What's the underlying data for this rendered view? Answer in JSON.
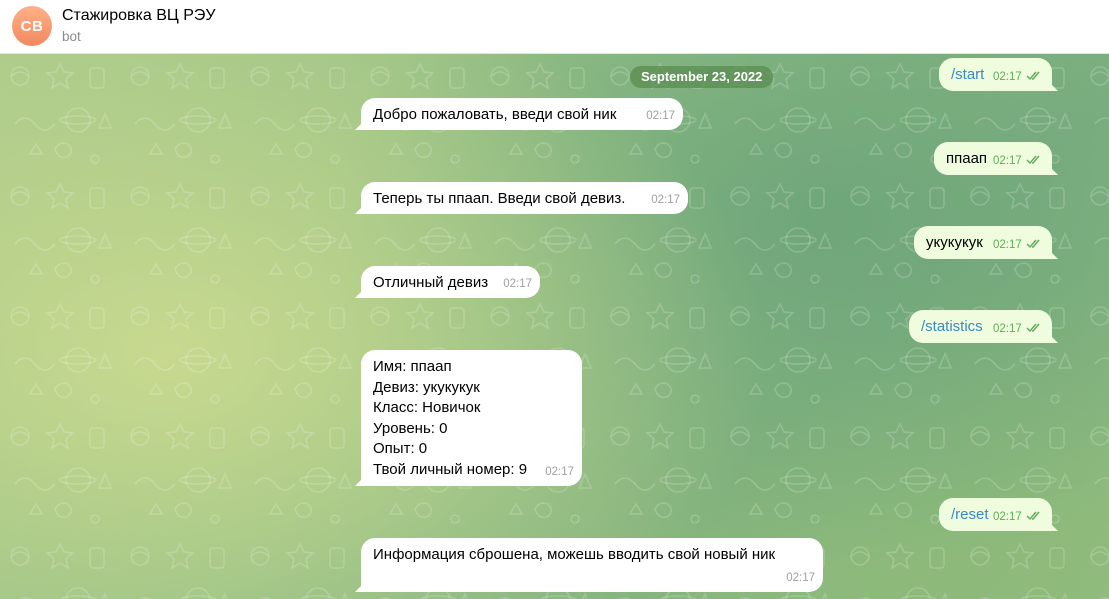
{
  "header": {
    "avatar_initials": "СВ",
    "title": "Стажировка ВЦ РЭУ",
    "subtitle": "bot"
  },
  "date_separator": "September 23, 2022",
  "messages": [
    {
      "side": "out",
      "text": "/start",
      "time": "02:17",
      "is_command": true
    },
    {
      "side": "in",
      "text": "Добро пожаловать, введи свой ник",
      "time": "02:17"
    },
    {
      "side": "out",
      "text": "ппаап",
      "time": "02:17"
    },
    {
      "side": "in",
      "text": "Теперь ты ппаап. Введи свой девиз.",
      "time": "02:17"
    },
    {
      "side": "out",
      "text": "укукукук",
      "time": "02:17"
    },
    {
      "side": "in",
      "text": "Отличный девиз",
      "time": "02:17"
    },
    {
      "side": "out",
      "text": "/statistics",
      "time": "02:17",
      "is_command": true
    },
    {
      "side": "in",
      "text": "Имя: ппаап\nДевиз: укукукук\nКласс: Новичок\nУровень: 0\nОпыт: 0\nТвой личный номер: 9",
      "time": "02:17"
    },
    {
      "side": "out",
      "text": "/reset",
      "time": "02:17",
      "is_command": true
    },
    {
      "side": "in",
      "text": "Информация сброшена, можешь вводить свой новый ник",
      "time": "02:17"
    }
  ],
  "colors": {
    "incoming_bubble": "#ffffff",
    "outgoing_bubble": "#effdde",
    "command_link": "#3a8ac4",
    "read_ticks": "#5fab59",
    "avatar": "#f2895f"
  },
  "icons": {
    "read_status": "double-check-icon",
    "wallpaper": "doodle-pattern"
  }
}
